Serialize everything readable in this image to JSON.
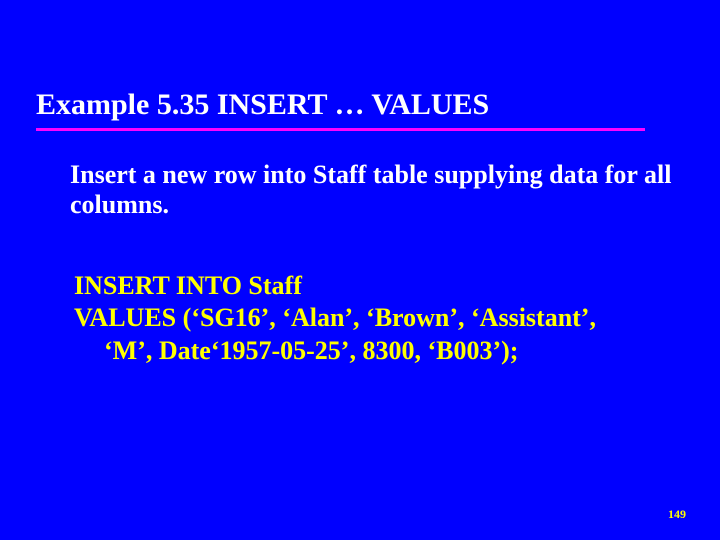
{
  "slide": {
    "title": "Example 5.35  INSERT … VALUES",
    "description": "Insert a new row into Staff table supplying data for all columns.",
    "sql_line1": "INSERT INTO Staff",
    "sql_line2": "VALUES  (‘SG16’,  ‘Alan’,  ‘Brown’,  ‘Assistant’,",
    "sql_line3": "‘M’, Date‘1957-05-25’, 8300, ‘B003’);",
    "page_number": "149"
  }
}
